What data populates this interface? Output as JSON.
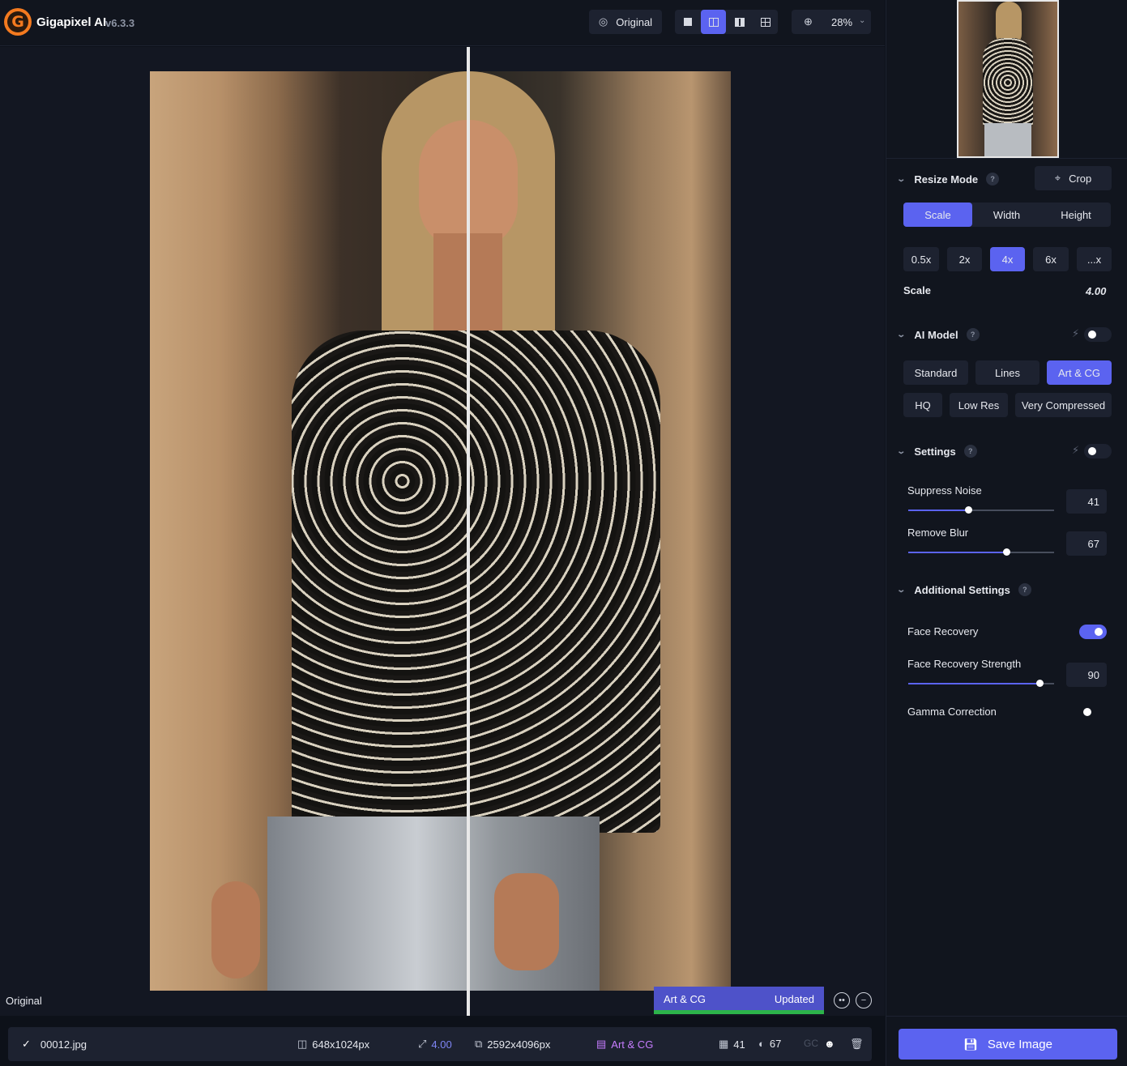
{
  "app": {
    "name": "Gigapixel AI",
    "version": "v6.3.3",
    "logo_letter": "G"
  },
  "toolbar": {
    "original_label": "Original",
    "zoom_value": "28%",
    "view_modes": [
      "single-view",
      "split-view",
      "side-by-side-view",
      "grid-view"
    ],
    "active_view": "split-view"
  },
  "preview": {
    "split_label": "Original",
    "status_model": "Art & CG",
    "status_text": "Updated",
    "status_colors": {
      "bar": "#2cb34a",
      "badge": "#4e52c9"
    }
  },
  "file": {
    "name": "00012.jpg",
    "input_size": "648x1024px",
    "scale": "4.00",
    "output_size": "2592x4096px",
    "model": "Art & CG",
    "noise": "41",
    "blur": "67",
    "gc_label": "GC"
  },
  "resize": {
    "title": "Resize Mode",
    "help": "?",
    "crop_label": "Crop",
    "modes": [
      "Scale",
      "Width",
      "Height"
    ],
    "active_mode": "Scale",
    "presets": [
      "0.5x",
      "2x",
      "4x",
      "6x",
      "...x"
    ],
    "active_preset": "4x",
    "scale_label": "Scale",
    "scale_value": "4.00"
  },
  "ai_model": {
    "title": "AI Model",
    "help": "?",
    "models_row1": [
      "Standard",
      "Lines",
      "Art & CG"
    ],
    "models_row2": [
      "HQ",
      "Low Res",
      "Very Compressed"
    ],
    "active_model": "Art & CG",
    "auto_enabled": false
  },
  "settings": {
    "title": "Settings",
    "help": "?",
    "auto_enabled": false,
    "suppress_noise_label": "Suppress Noise",
    "suppress_noise_value": "41",
    "suppress_noise_level": 0.41,
    "remove_blur_label": "Remove Blur",
    "remove_blur_value": "67",
    "remove_blur_level": 0.67
  },
  "additional": {
    "title": "Additional Settings",
    "help": "?",
    "face_recovery_label": "Face Recovery",
    "face_recovery_on": true,
    "face_strength_label": "Face Recovery Strength",
    "face_strength_value": "90",
    "face_strength_level": 0.9,
    "gamma_label": "Gamma Correction",
    "gamma_on": false
  },
  "save": {
    "label": "Save Image"
  },
  "colors": {
    "accent": "#5b63f0",
    "panel_bg": "#11151e",
    "control_bg": "#1d2230",
    "logo": "#f47a1f",
    "model_tag": "#c77dff"
  }
}
